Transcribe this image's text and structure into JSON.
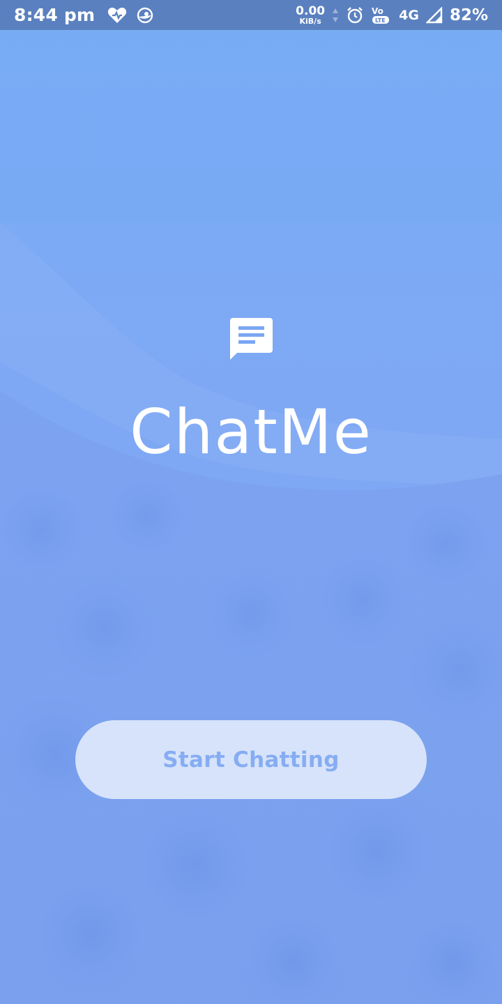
{
  "status_bar": {
    "time": "8:44 pm",
    "speed_value": "0.00",
    "speed_unit": "KiB/s",
    "volte_label": "LTE",
    "network": "4G",
    "battery": "82%",
    "icons": [
      "heart-icon",
      "chrome-like-icon",
      "alarm-icon",
      "volte-icon",
      "signal-icon"
    ]
  },
  "app": {
    "title": "ChatMe",
    "logo_icon": "chat-bubble-icon"
  },
  "cta": {
    "label": "Start Chatting"
  },
  "colors": {
    "status_bar": "#5a80bf",
    "background_tint": "#7aa6f3",
    "button_bg": "#ecf2fd",
    "button_text": "#86adf3",
    "title_text": "#ffffff"
  }
}
